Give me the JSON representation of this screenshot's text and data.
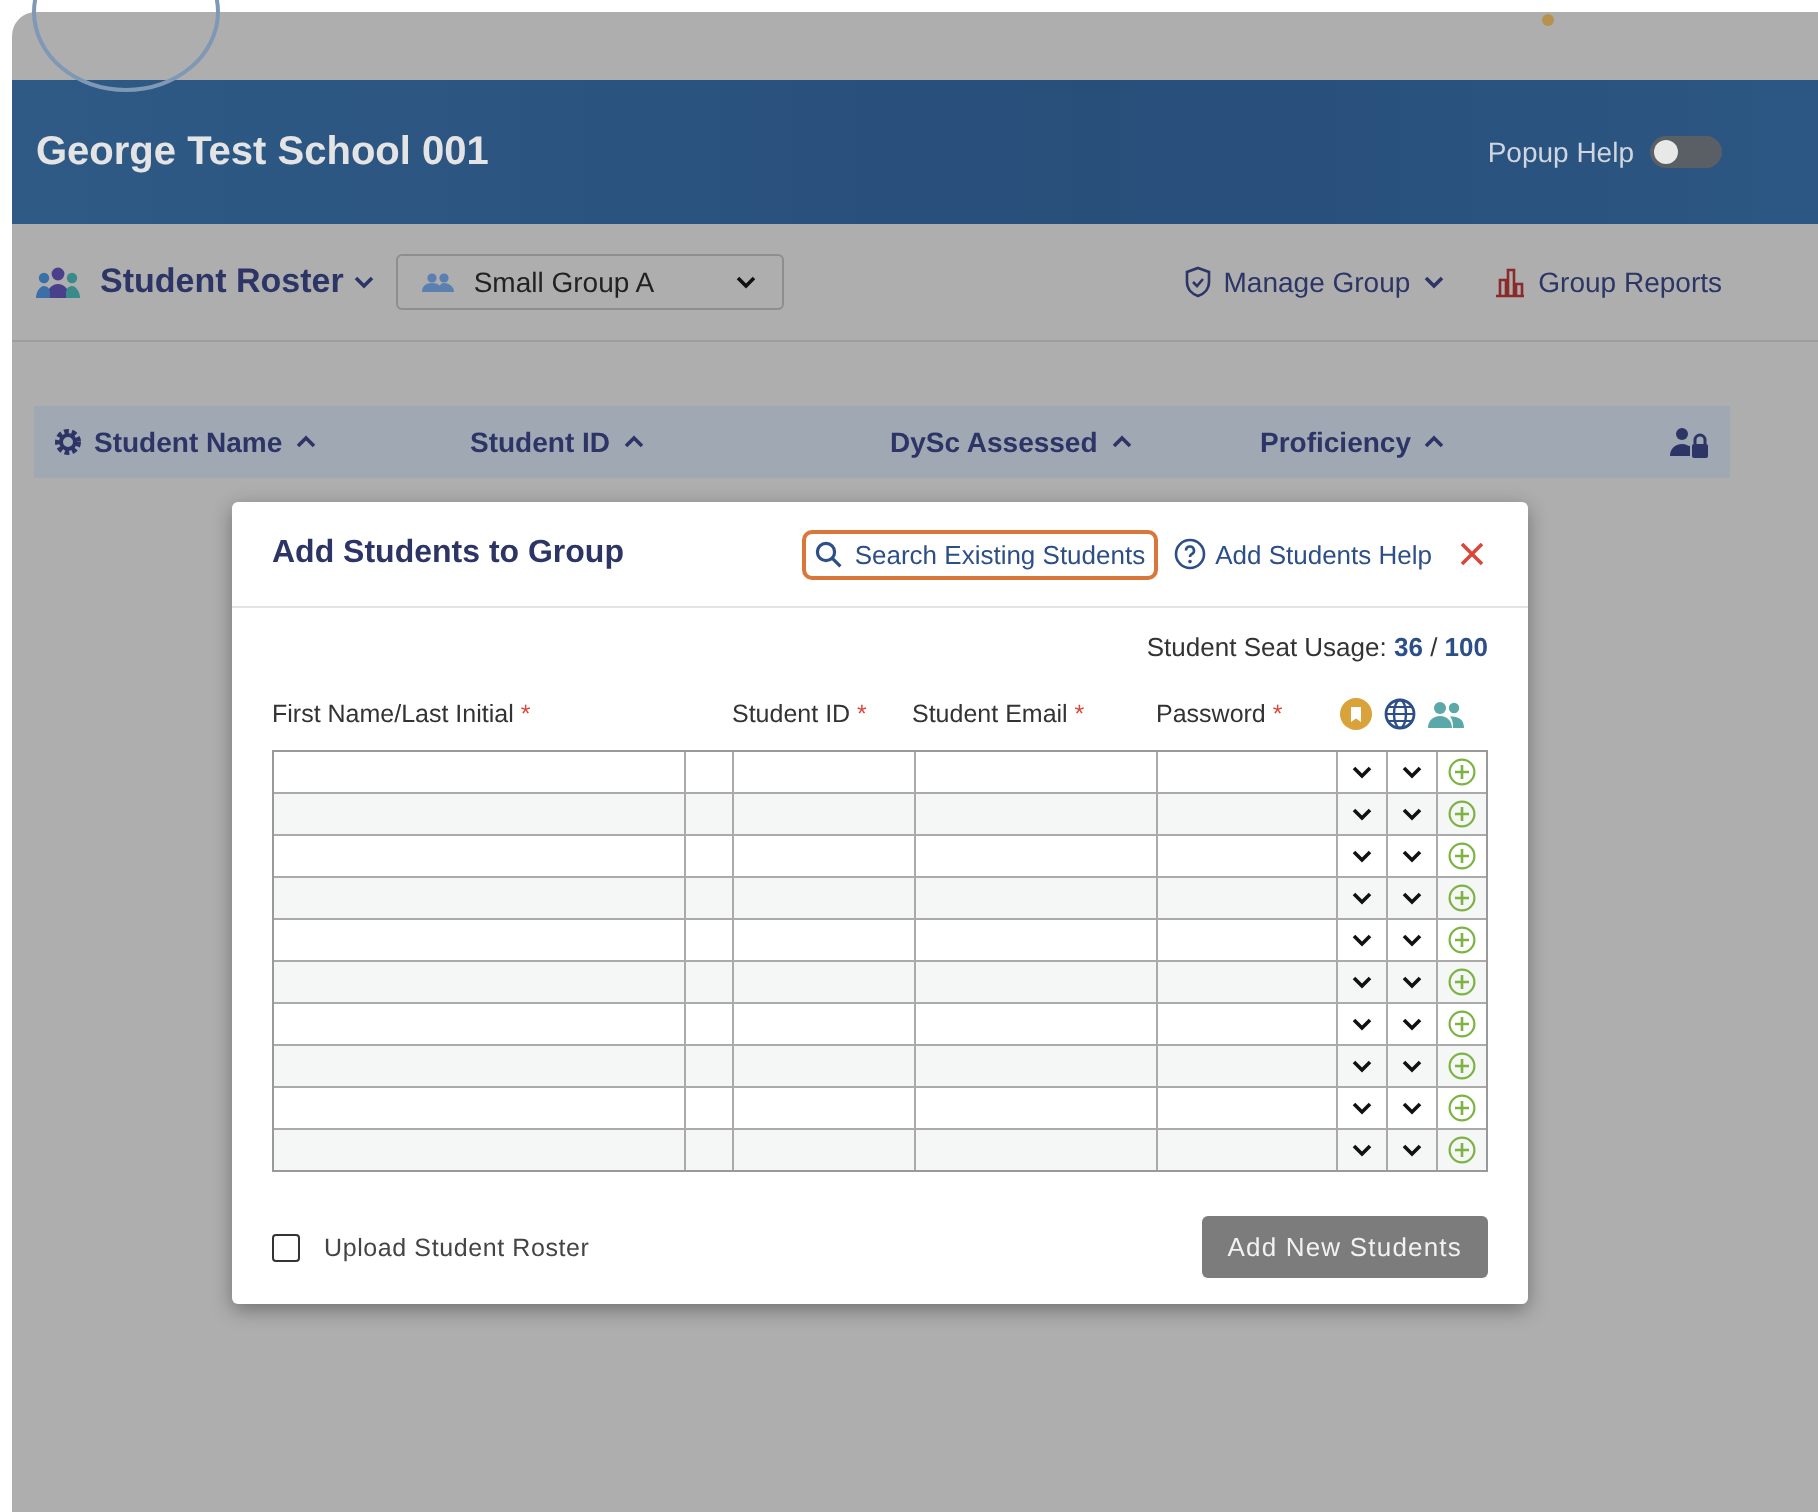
{
  "header": {
    "school": "George Test School 001",
    "popup_help": {
      "label": "Popup Help",
      "on": false
    }
  },
  "toolbar": {
    "roster": "Student Roster",
    "group_select": {
      "value": "Small Group A"
    },
    "manage": "Manage Group",
    "reports": "Group Reports"
  },
  "table": {
    "columns": [
      "Student Name",
      "Student ID",
      "DySc Assessed",
      "Proficiency"
    ]
  },
  "dialog": {
    "title": "Add Students to Group",
    "search": "Search Existing Students",
    "help": "Add Students Help",
    "seat_usage": {
      "label": "Student Seat Usage:",
      "used": "36",
      "separator": "/",
      "total": "100"
    },
    "columns": [
      {
        "label": "First Name/Last Initial",
        "required": true
      },
      {
        "label": "Student ID",
        "required": true
      },
      {
        "label": "Student Email",
        "required": true
      },
      {
        "label": "Password",
        "required": true
      }
    ],
    "required_mark": "*",
    "rows": [
      {
        "kind": "entry"
      },
      {
        "kind": "entry"
      },
      {
        "kind": "entry"
      },
      {
        "kind": "entry"
      },
      {
        "kind": "entry"
      },
      {
        "kind": "entry"
      },
      {
        "kind": "entry"
      },
      {
        "kind": "entry"
      },
      {
        "kind": "entry"
      },
      {
        "kind": "entry"
      }
    ],
    "upload": {
      "label": "Upload Student Roster",
      "checked": false
    },
    "submit": "Add New Students"
  }
}
